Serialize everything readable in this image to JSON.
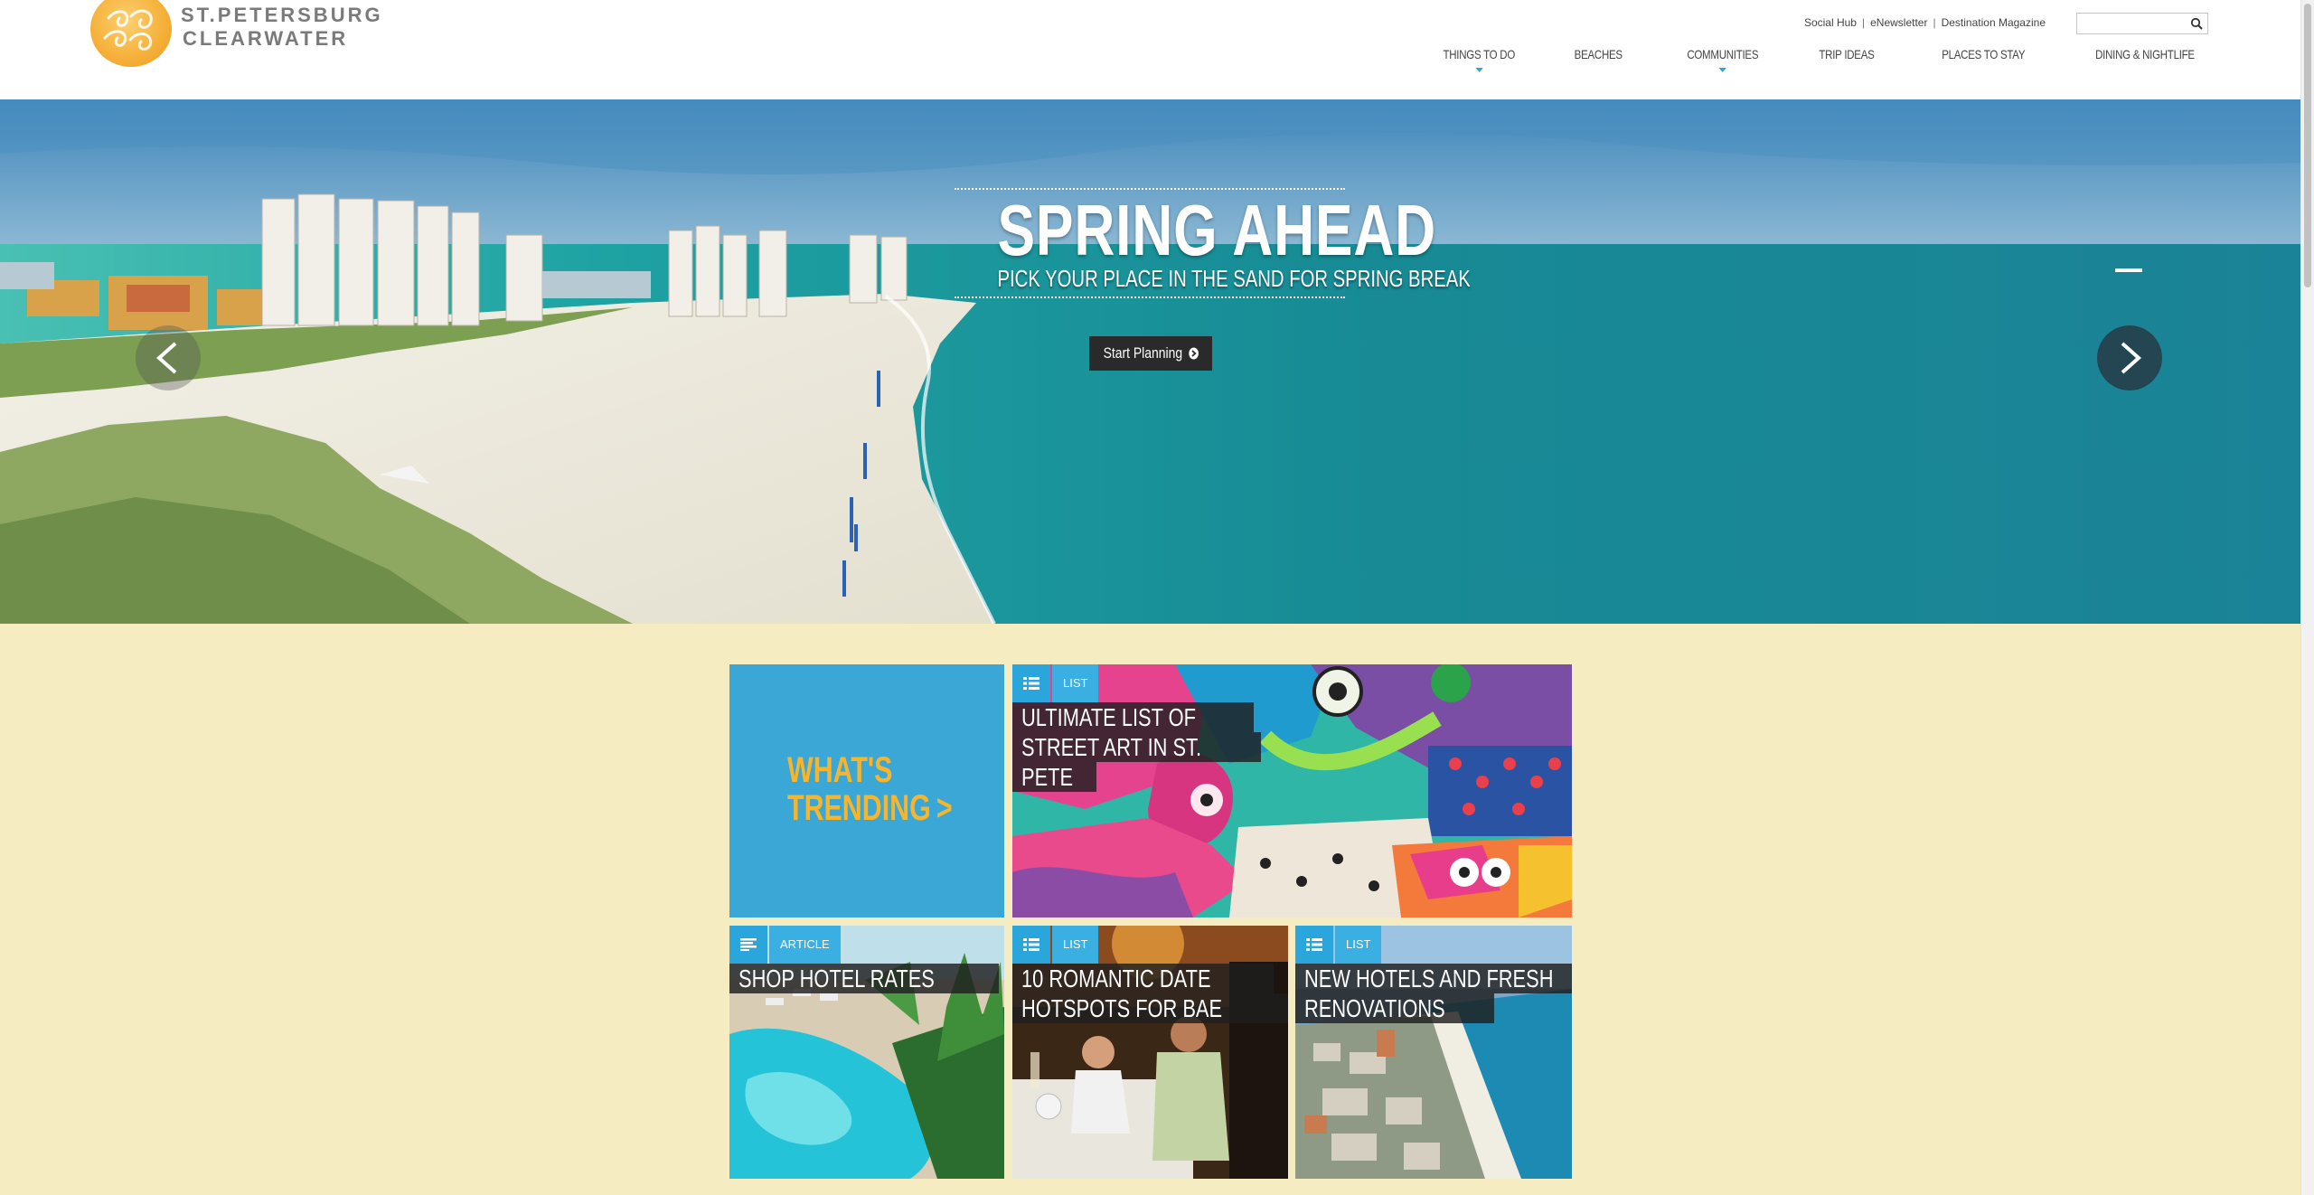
{
  "header": {
    "logo": {
      "line1": "ST.PETERSBURG",
      "line2": "CLEARWATER"
    },
    "utility_links": [
      "Social Hub",
      "eNewsletter",
      "Destination Magazine"
    ],
    "utility_separator": "|",
    "search": {
      "placeholder": "",
      "value": ""
    },
    "nav": [
      {
        "label": "THINGS TO DO",
        "has_dropdown": true
      },
      {
        "label": "BEACHES",
        "has_dropdown": false
      },
      {
        "label": "COMMUNITIES",
        "has_dropdown": true
      },
      {
        "label": "TRIP IDEAS",
        "has_dropdown": false
      },
      {
        "label": "PLACES TO STAY",
        "has_dropdown": false
      },
      {
        "label": "DINING & NIGHTLIFE",
        "has_dropdown": false
      }
    ]
  },
  "hero": {
    "title": "SPRING AHEAD",
    "subtitle": "PICK YOUR PLACE IN THE SAND FOR SPRING BREAK",
    "cta": "Start Planning",
    "prev_arrow": "<",
    "next_arrow": ">"
  },
  "trending": {
    "heading_line1": "WHAT'S",
    "heading_line2": "TRENDING",
    "chevron": ">",
    "tiles": [
      {
        "type": "LIST",
        "icon": "list-icon",
        "title_lines": [
          "ULTIMATE LIST OF",
          "STREET ART IN ST.",
          "PETE"
        ]
      },
      {
        "type": "ARTICLE",
        "icon": "article-icon",
        "title_lines": [
          "SHOP HOTEL RATES"
        ]
      },
      {
        "type": "LIST",
        "icon": "list-icon",
        "title_lines": [
          "10 ROMANTIC DATE",
          "HOTSPOTS FOR BAE"
        ]
      },
      {
        "type": "LIST",
        "icon": "list-icon",
        "title_lines": [
          "NEW HOTELS AND FRESH",
          "RENOVATIONS"
        ]
      }
    ]
  },
  "colors": {
    "accent_blue": "#2aa6dc",
    "trending_bg": "#3aa7d6",
    "trending_text": "#f7b52b",
    "page_bg": "#f5ecc2"
  }
}
